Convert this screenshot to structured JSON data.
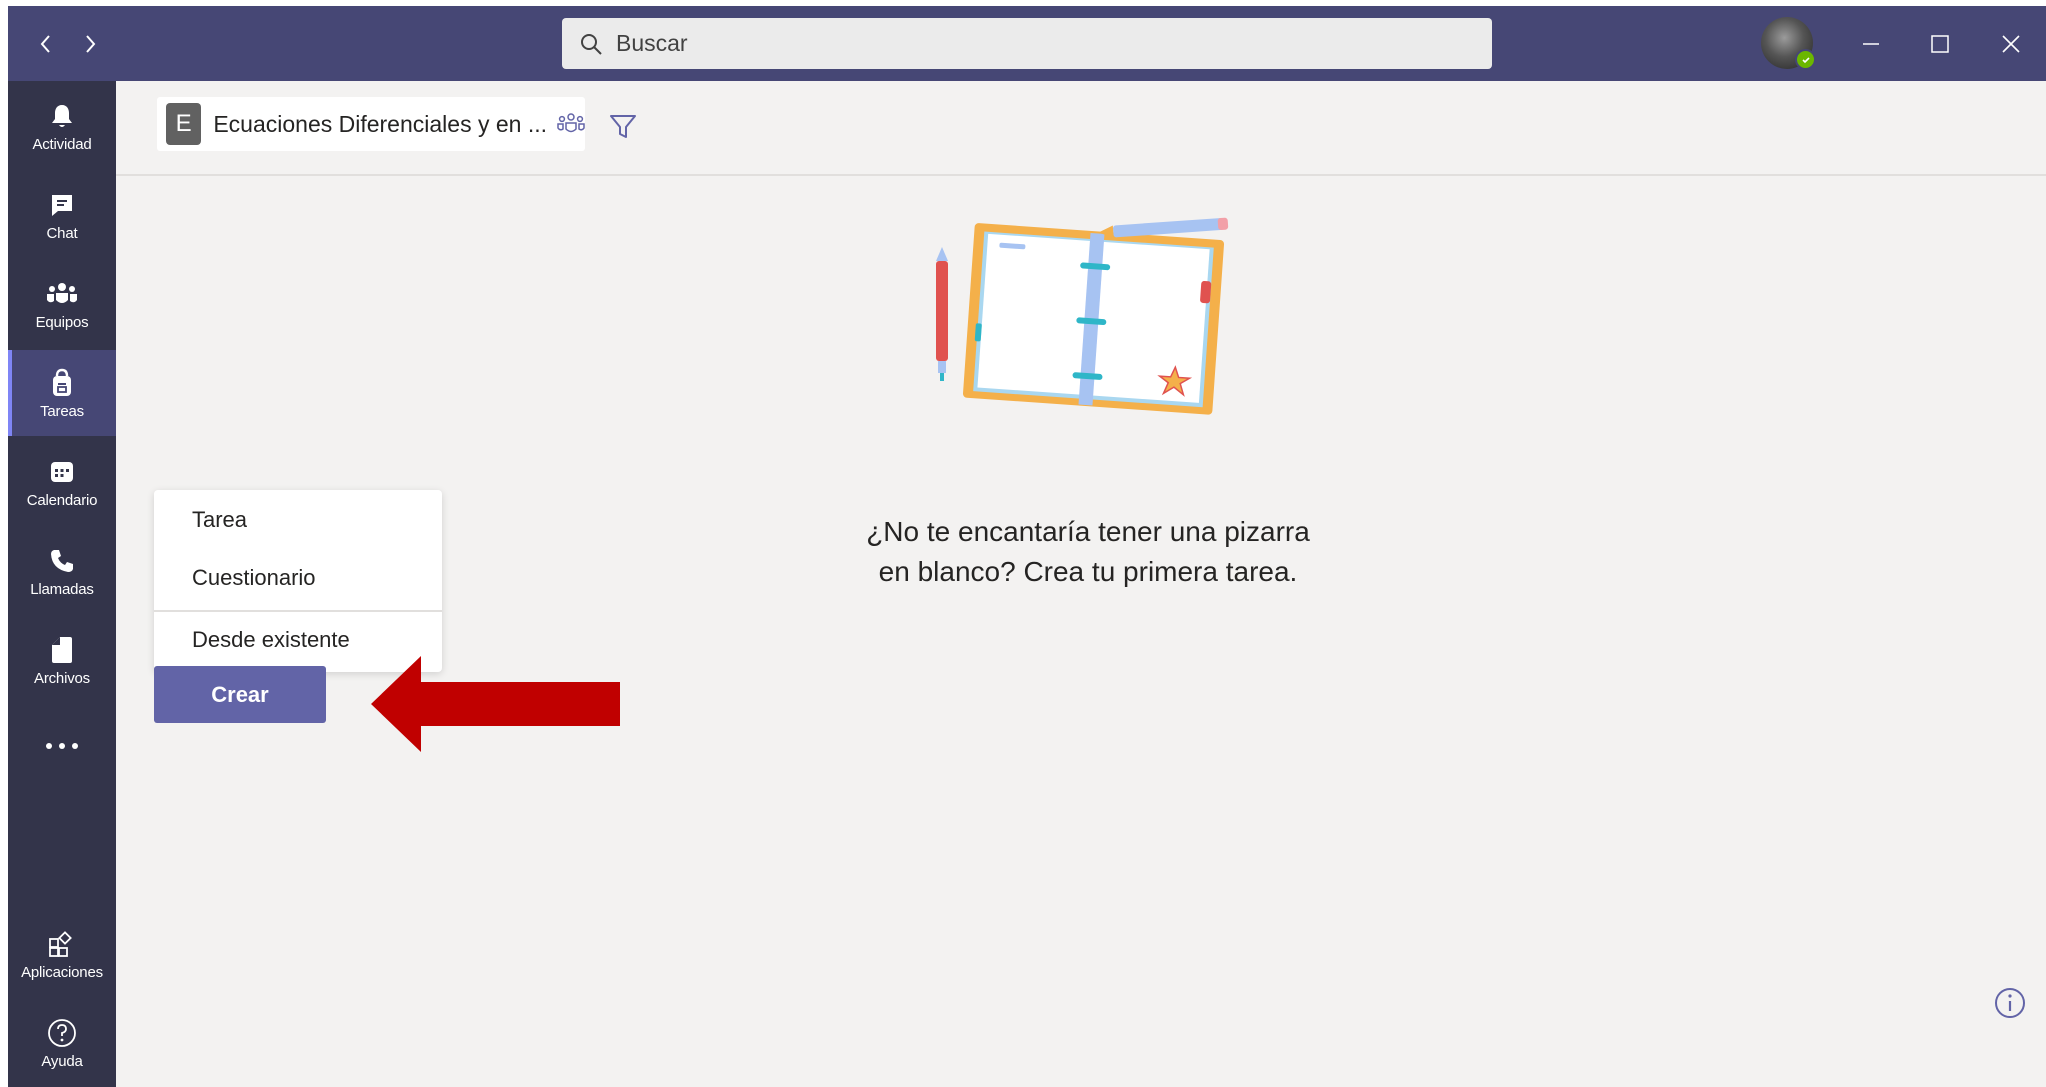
{
  "search": {
    "placeholder": "Buscar"
  },
  "rail": {
    "items": [
      {
        "label": "Actividad",
        "icon": "bell-icon"
      },
      {
        "label": "Chat",
        "icon": "chat-icon"
      },
      {
        "label": "Equipos",
        "icon": "teams-icon"
      },
      {
        "label": "Tareas",
        "icon": "assignments-icon",
        "active": true
      },
      {
        "label": "Calendario",
        "icon": "calendar-icon"
      },
      {
        "label": "Llamadas",
        "icon": "phone-icon"
      },
      {
        "label": "Archivos",
        "icon": "file-icon"
      }
    ],
    "bottom": [
      {
        "label": "Aplicaciones",
        "icon": "apps-icon"
      },
      {
        "label": "Ayuda",
        "icon": "help-icon"
      }
    ]
  },
  "class": {
    "initial": "E",
    "name": "Ecuaciones Diferenciales y en ..."
  },
  "empty_state": {
    "line1": "¿No te encantaría tener una pizarra",
    "line2": "en blanco? Crea tu primera tarea."
  },
  "menu": {
    "items": [
      "Tarea",
      "Cuestionario",
      "Desde existente"
    ]
  },
  "create_label": "Crear",
  "colors": {
    "titlebar": "#464775",
    "rail": "#33344a",
    "accent": "#6264a7",
    "arrow": "#c00000"
  }
}
